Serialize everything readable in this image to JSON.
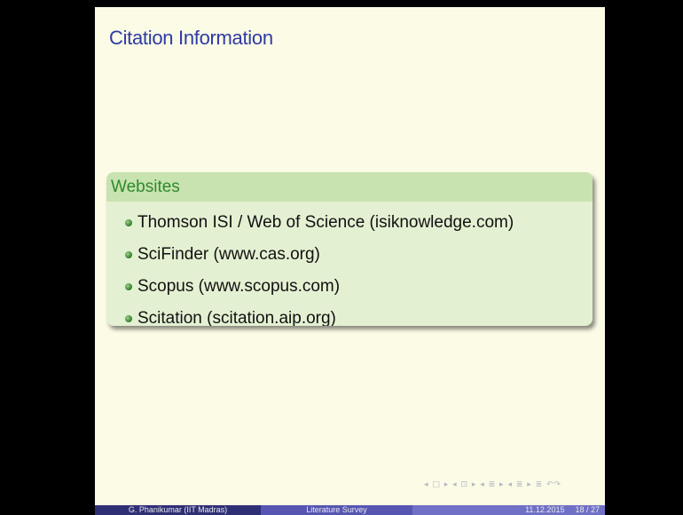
{
  "slide": {
    "title": "Citation Information",
    "block": {
      "heading": "Websites",
      "items": [
        {
          "text": "Thomson ISI / Web of Science (isiknowledge.com)"
        },
        {
          "text": "SciFinder (www.cas.org)"
        },
        {
          "text": "Scopus (www.scopus.com)"
        },
        {
          "text": "Scitation (scitation.aip.org)"
        }
      ]
    },
    "nav_symbols": "◂ □ ▸  ◂ ⊡ ▸  ◂ ≣ ▸  ◂ ≣ ▸   ≣   ↶↷",
    "footer": {
      "author": "G. Phanikumar  (IIT Madras)",
      "talk": "Literature Survey",
      "date": "11.12.2015",
      "page": "18 / 27"
    }
  },
  "colors": {
    "background": "#000000",
    "slide_bg": "#fbfbe6",
    "title": "#2f3aa3",
    "block_head_bg": "#c8e2b0",
    "block_head_text": "#2f8a2c",
    "block_body_bg": "#e4f0d2",
    "footer_left": "#2f2f75",
    "footer_mid": "#5656b2",
    "footer_right": "#7070c6"
  }
}
